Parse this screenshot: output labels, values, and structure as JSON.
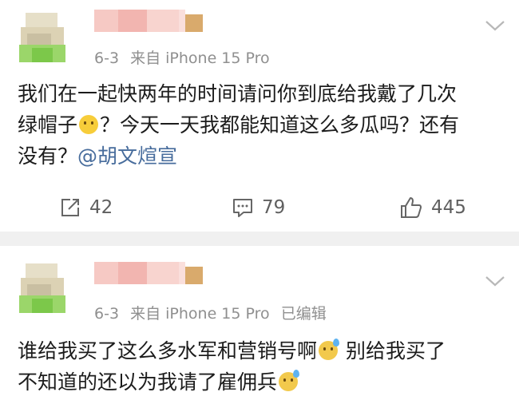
{
  "posts": [
    {
      "meta": {
        "date": "6-3",
        "source": "来自 iPhone 15 Pro",
        "edited": ""
      },
      "content": {
        "line1": "我们在一起快两年的时间请问你到底给我戴了几次",
        "line2a": "绿帽子",
        "line2b": "？今天一天我都能知道这么多瓜吗？还有",
        "line3a": "没有？",
        "mention": "@胡文煊宣"
      },
      "emoji": [
        "smile-icon"
      ],
      "actions": {
        "repost": "42",
        "comment": "79",
        "like": "445"
      }
    },
    {
      "meta": {
        "date": "6-3",
        "source": "来自 iPhone 15 Pro",
        "edited": "已编辑"
      },
      "content": {
        "line1a": "谁给我买了这么多水军和营销号啊",
        "line1b": " 别给我买了",
        "line2": "不知道的还以为我请了雇佣兵"
      },
      "emoji": [
        "sweat-icon",
        "sweat-icon"
      ]
    }
  ],
  "colors": {
    "mention": "#476c9c",
    "meta": "#8f8f8f",
    "divider": "#f0f0f0"
  }
}
